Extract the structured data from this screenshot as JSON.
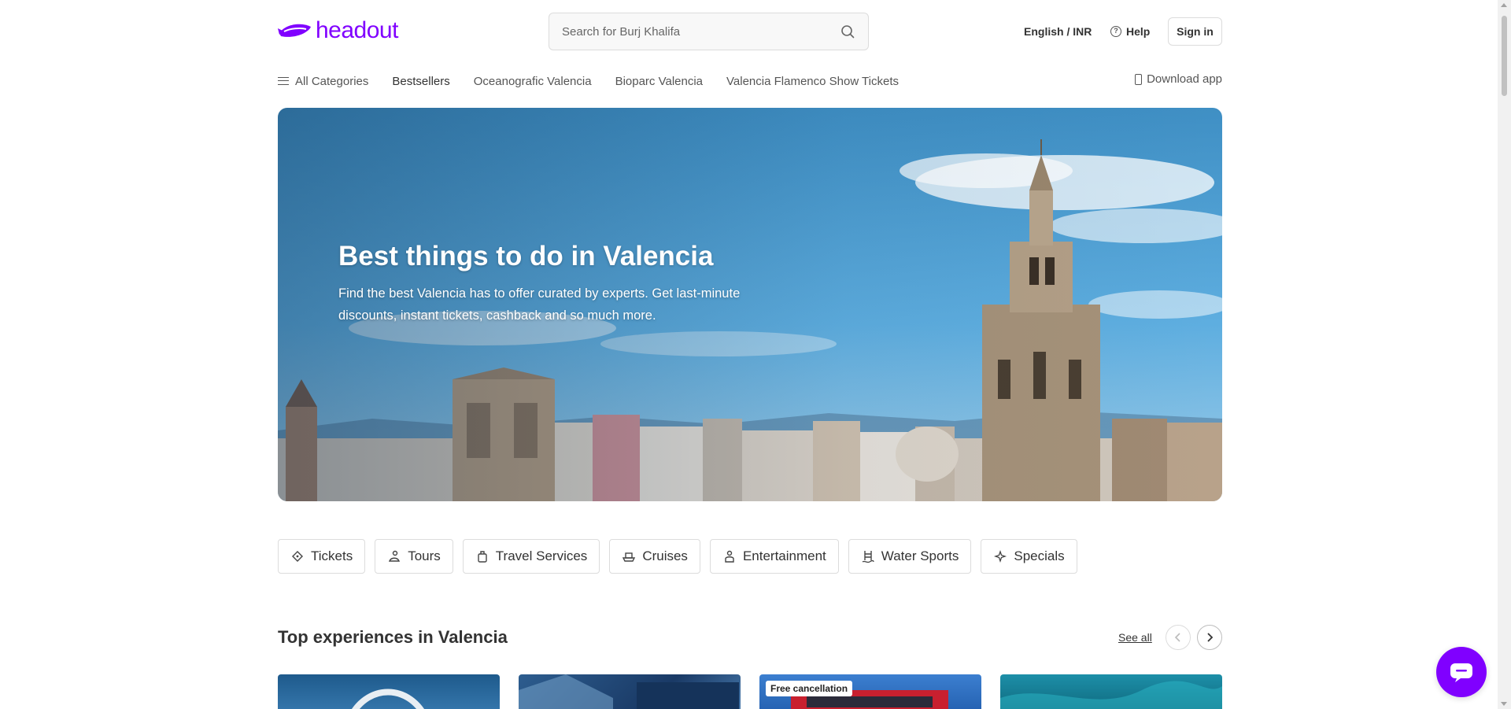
{
  "brand": {
    "name": "headout",
    "color": "#8000ff"
  },
  "search": {
    "placeholder": "Search for Burj Khalifa",
    "icon": "search-icon"
  },
  "header": {
    "language_currency": "English / INR",
    "help_label": "Help",
    "signin_label": "Sign in"
  },
  "nav": {
    "all_categories": "All Categories",
    "items": [
      "Bestsellers",
      "Oceanografic Valencia",
      "Bioparc Valencia",
      "Valencia Flamenco Show Tickets"
    ],
    "download_app": "Download app"
  },
  "hero": {
    "title": "Best things to do in Valencia",
    "subtitle": "Find the best Valencia has to offer curated by experts. Get last-minute discounts, instant tickets, cashback and so much more."
  },
  "categories": [
    {
      "label": "Tickets",
      "icon": "ticket-icon"
    },
    {
      "label": "Tours",
      "icon": "tour-icon"
    },
    {
      "label": "Travel Services",
      "icon": "travel-services-icon"
    },
    {
      "label": "Cruises",
      "icon": "cruise-icon"
    },
    {
      "label": "Entertainment",
      "icon": "entertainment-icon"
    },
    {
      "label": "Water Sports",
      "icon": "water-sports-icon"
    },
    {
      "label": "Specials",
      "icon": "specials-icon"
    }
  ],
  "section": {
    "title": "Top experiences in Valencia",
    "see_all": "See all"
  },
  "cards": [
    {
      "badge": ""
    },
    {
      "badge": ""
    },
    {
      "badge": "Free cancellation"
    },
    {
      "badge": ""
    }
  ]
}
